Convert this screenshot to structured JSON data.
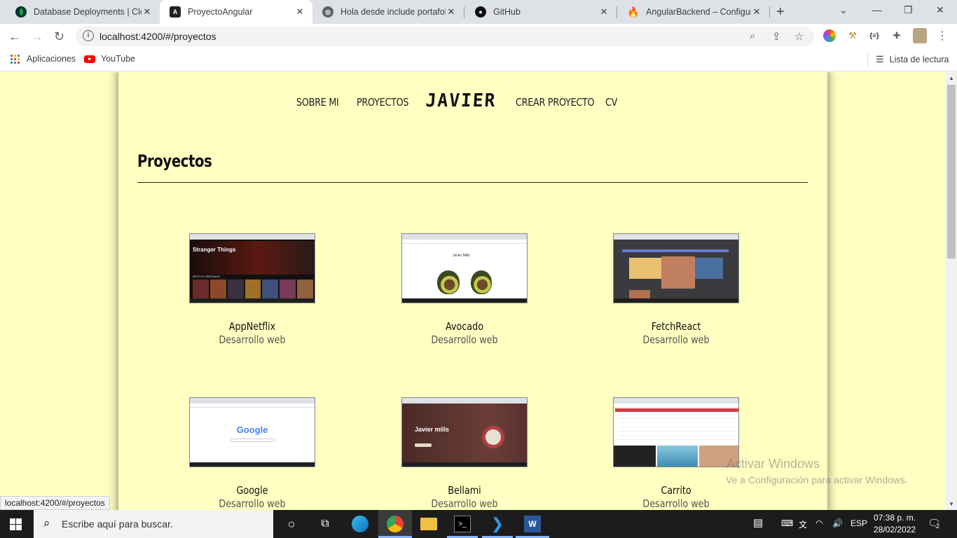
{
  "browser": {
    "tabs": [
      {
        "title": "Database Deployments | Clou",
        "icon": "mongodb-leaf-icon",
        "active": false
      },
      {
        "title": "ProyectoAngular",
        "icon": "angular-icon",
        "active": true
      },
      {
        "title": "Hola desde include portafolio",
        "icon": "globe-icon",
        "active": false
      },
      {
        "title": "GitHub",
        "icon": "github-icon",
        "active": false
      },
      {
        "title": "AngularBackend – Configura",
        "icon": "firebase-icon",
        "active": false
      }
    ],
    "url": "localhost:4200/#/proyectos",
    "bookmarks": {
      "apps_label": "Aplicaciones",
      "youtube_label": "YouTube",
      "reading_list_label": "Lista de lectura"
    }
  },
  "site": {
    "nav": {
      "sobre_mi": "SOBRE MI",
      "proyectos": "PROYECTOS",
      "brand": "JAVIER",
      "crear_proyecto": "CREAR PROYECTO",
      "cv": "CV"
    },
    "section_title": "Proyectos",
    "projects": [
      {
        "name": "AppNetflix",
        "category": "Desarrollo web"
      },
      {
        "name": "Avocado",
        "category": "Desarrollo web"
      },
      {
        "name": "FetchReact",
        "category": "Desarrollo web"
      },
      {
        "name": "Google",
        "category": "Desarrollo web"
      },
      {
        "name": "Bellami",
        "category": "Desarrollo web"
      },
      {
        "name": "Carrito",
        "category": "Desarrollo web"
      }
    ],
    "thumbnails": {
      "netflix_title": "Stranger Things",
      "netflix_row": "NETFLIX ORIGINALS",
      "avocado_logo": "Javier Mills",
      "google_logo": "Google",
      "bellami_title": "Javier mills"
    }
  },
  "status_url": "localhost:4200/#/proyectos",
  "watermark": {
    "line1": "Activar Windows",
    "line2": "Ve a Configuración para activar Windows."
  },
  "taskbar": {
    "search_placeholder": "Escribe aquí para buscar.",
    "language": "ESP",
    "time": "07:38 p. m.",
    "date": "28/02/2022",
    "notifications": "2"
  },
  "colors": {
    "page_background": "#ffffc2",
    "taskbar": "#1c1c1c"
  }
}
